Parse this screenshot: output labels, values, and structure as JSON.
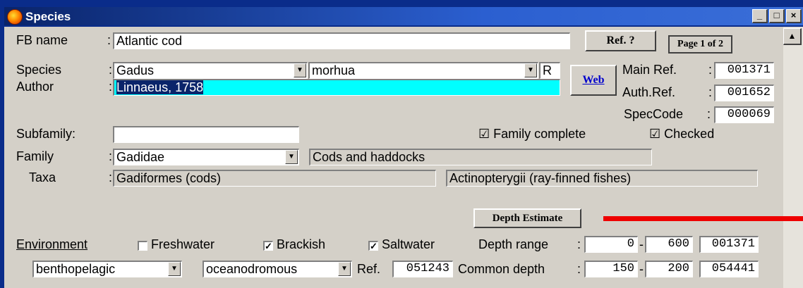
{
  "window": {
    "title": "Species",
    "min": "_",
    "max": "□",
    "close": "×"
  },
  "header": {
    "ref_button": "Ref. ?",
    "page": "Page 1 of 2",
    "web_button": "Web"
  },
  "fb_name": {
    "label": "FB name",
    "colon": ":",
    "value": "Atlantic cod"
  },
  "species": {
    "label": "Species",
    "colon": ":",
    "genus": "Gadus",
    "species": "morhua",
    "flag": "R"
  },
  "author": {
    "label": "Author",
    "colon": ":",
    "value": "Linnaeus, 1758"
  },
  "refs": {
    "main_ref_label": "Main Ref.",
    "main_ref": "001371",
    "auth_ref_label": "Auth.Ref.",
    "auth_ref": "001652",
    "speccode_label": "SpecCode",
    "speccode": "000069",
    "colon": ":"
  },
  "subfamily": {
    "label": "Subfamily:",
    "value": ""
  },
  "checks": {
    "family_complete": "Family complete",
    "checked": "Checked",
    "mark": "☑"
  },
  "family": {
    "label": "Family",
    "colon": ":",
    "value": "Gadidae",
    "common": "Cods and haddocks"
  },
  "taxa": {
    "label": "Taxa",
    "colon": ":",
    "order": "Gadiformes (cods)",
    "class": "Actinopterygii (ray-finned fishes)"
  },
  "depth_button": "Depth Estimate",
  "environment": {
    "label": "Environment",
    "freshwater": "Freshwater",
    "freshwater_checked": false,
    "brackish": "Brackish",
    "brackish_checked": true,
    "saltwater": "Saltwater",
    "saltwater_checked": true,
    "check_mark": "✓"
  },
  "depth_range": {
    "label": "Depth range",
    "colon": ":",
    "min": "0",
    "dash": "-",
    "max": "600",
    "ref": "001371"
  },
  "common_depth": {
    "label": "Common depth",
    "colon": ":",
    "min": "150",
    "dash": "-",
    "max": "200",
    "ref": "054441"
  },
  "habitat": {
    "zone": "benthopelagic",
    "migration": "oceanodromous",
    "ref_label": "Ref.",
    "ref": "051243"
  },
  "icons": {
    "dropdown": "▼",
    "scroll_up": "▲"
  },
  "colors": {
    "title_bar": "#0a246a",
    "dialog": "#d4d0c8",
    "author_field": "#00ffff",
    "annotation_line": "#ee0000"
  }
}
